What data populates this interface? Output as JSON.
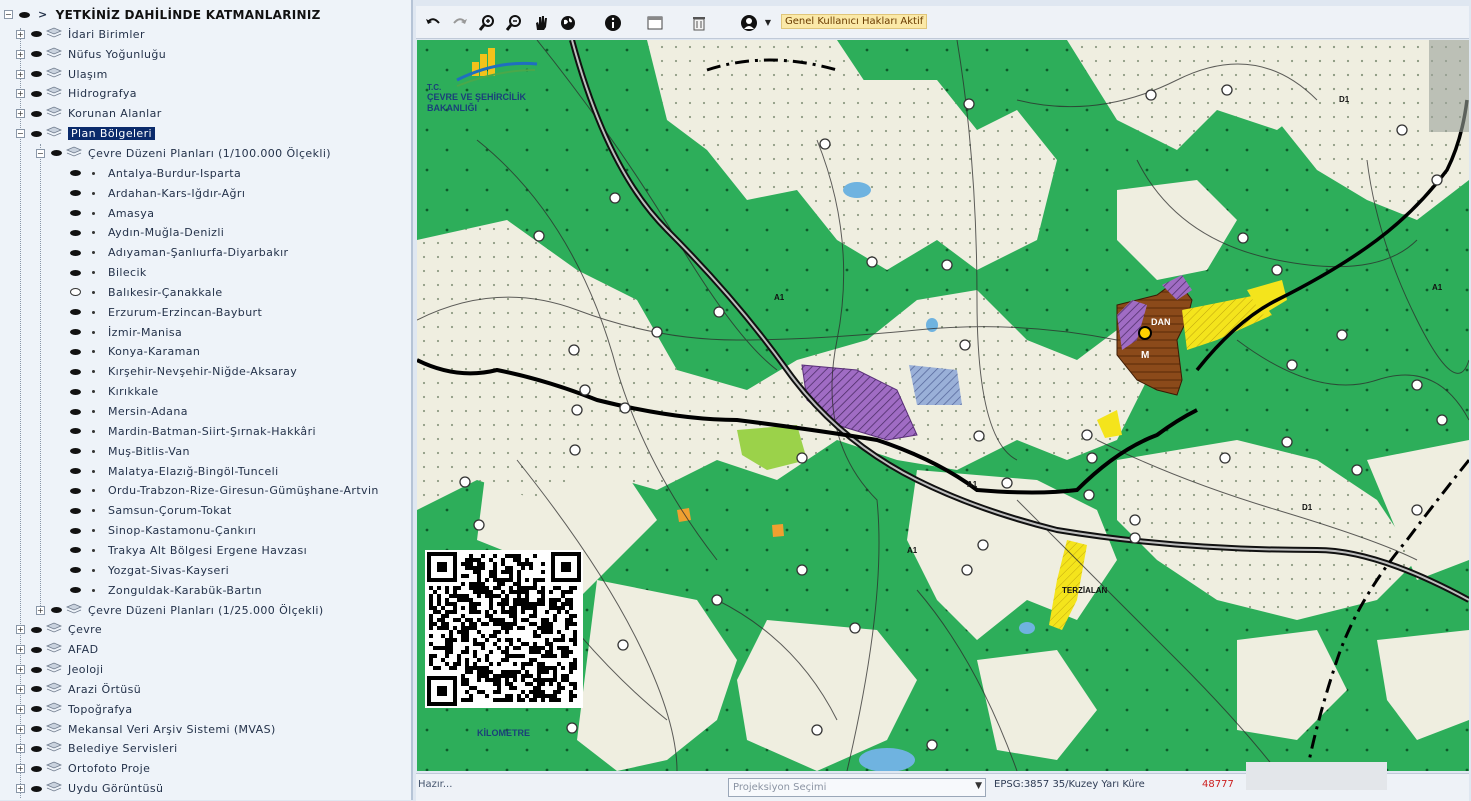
{
  "tree": {
    "header": "YETKİNİZ DAHİLİNDE KATMANLARINIZ",
    "top_layers": [
      "İdari Birimler",
      "Nüfus Yoğunluğu",
      "Ulaşım",
      "Hidrografya",
      "Korunan Alanlar"
    ],
    "selected_layer": "Plan Bölgeleri",
    "sub_group_100k": "Çevre Düzeni Planları (1/100.000 Ölçekli)",
    "plans": [
      "Antalya-Burdur-Isparta",
      "Ardahan-Kars-Iğdır-Ağrı",
      "Amasya",
      "Aydın-Muğla-Denizli",
      "Adıyaman-Şanlıurfa-Diyarbakır",
      "Bilecik",
      "Balıkesir-Çanakkale",
      "Erzurum-Erzincan-Bayburt",
      "İzmir-Manisa",
      "Konya-Karaman",
      "Kırşehir-Nevşehir-Niğde-Aksaray",
      "Kırıkkale",
      "Mersin-Adana",
      "Mardin-Batman-Siirt-Şırnak-Hakkâri",
      "Muş-Bitlis-Van",
      "Malatya-Elazığ-Bingöl-Tunceli",
      "Ordu-Trabzon-Rize-Giresun-Gümüşhane-Artvin",
      "Samsun-Çorum-Tokat",
      "Sinop-Kastamonu-Çankırı",
      "Trakya Alt Bölgesi Ergene Havzası",
      "Yozgat-Sivas-Kayseri",
      "Zonguldak-Karabük-Bartın"
    ],
    "sub_group_25k": "Çevre Düzeni Planları (1/25.000 Ölçekli)",
    "bottom_layers": [
      "Çevre",
      "AFAD",
      "Jeoloji",
      "Arazi Örtüsü",
      "Topoğrafya",
      "Mekansal Veri Arşiv Sistemi (MVAS)",
      "Belediye Servisleri",
      "Ortofoto Proje",
      "Uydu Görüntüsü"
    ]
  },
  "toolbar": {
    "undo_icon": "undo-icon",
    "redo_icon": "redo-icon",
    "zoom_in_icon": "zoom-in-icon",
    "zoom_out_icon": "zoom-out-icon",
    "pan_icon": "hand-icon",
    "globe_icon": "globe-icon",
    "info_icon": "info-icon",
    "window_icon": "window-icon",
    "delete_icon": "trash-icon",
    "user_icon": "user-icon",
    "notice": "Genel Kullanıcı Hakları Aktif"
  },
  "map": {
    "logo_line1": "T.C.",
    "logo_line2": "ÇEVRE VE ŞEHİRCİLİK",
    "logo_line3": "BAKANLIĞI",
    "labels": [
      "DAN",
      "M",
      "TERZİALAN",
      "KİLOMETRE",
      "A1",
      "D1"
    ],
    "colors": {
      "forest": "#2dae5a",
      "agri": "#efeee0",
      "road": "#111111",
      "settlement": "#7a3b12",
      "industry": "#f5e51f",
      "protected": "#8a4fa8",
      "water": "#6fb3e0"
    }
  },
  "status": {
    "ready": "Hazır...",
    "projection_placeholder": "Projeksiyon Seçimi",
    "epsg": "EPSG:3857 35/Kuzey Yarı Küre",
    "coord": "48777"
  }
}
